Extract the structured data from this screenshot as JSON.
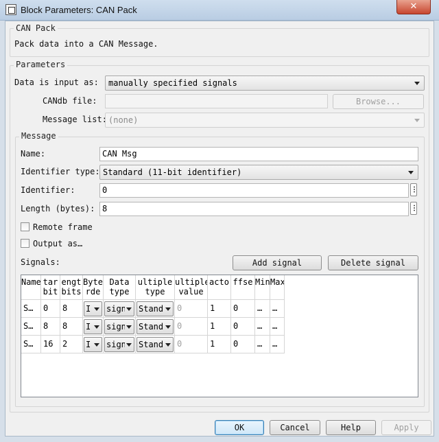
{
  "window": {
    "title": "Block Parameters: CAN Pack",
    "close_glyph": "✕"
  },
  "block": {
    "name": "CAN Pack",
    "description": "Pack data into a CAN Message."
  },
  "parameters": {
    "legend": "Parameters",
    "input_label": "Data is input as:",
    "input_value": "manually specified signals",
    "candb_label": "CANdb file:",
    "candb_value": "",
    "browse_label": "Browse...",
    "message_list_label": "Message list:",
    "message_list_value": "(none)"
  },
  "message": {
    "legend": "Message",
    "name_label": "Name:",
    "name_value": "CAN Msg",
    "id_type_label": "Identifier type:",
    "id_type_value": "Standard (11-bit identifier)",
    "identifier_label": "Identifier:",
    "identifier_value": "0",
    "length_label": "Length (bytes):",
    "length_value": "8",
    "remote_frame_label": "Remote frame",
    "remote_frame_checked": false,
    "output_as_label": "Output as…",
    "output_as_checked": false,
    "more_glyph": "⋮"
  },
  "signals": {
    "label": "Signals:",
    "add_label": "Add signal",
    "delete_label": "Delete signal",
    "columns": [
      [
        "Name",
        ""
      ],
      [
        "tar",
        "bit"
      ],
      [
        "engt",
        "bits"
      ],
      [
        "Byte",
        "rde"
      ],
      [
        "Data",
        "type"
      ],
      [
        "ultiple",
        "type"
      ],
      [
        "ultiple",
        "value"
      ],
      [
        "acto",
        ""
      ],
      [
        "ffse",
        ""
      ],
      [
        "Min",
        ""
      ],
      [
        "Max",
        ""
      ]
    ],
    "rows": [
      {
        "name": "S…",
        "start": "0",
        "length": "8",
        "byte_order": "I",
        "data_type": "sign",
        "mux_type": "Stand",
        "mux_value": "0",
        "factor": "1",
        "offset": "0",
        "min": "…",
        "max": "…"
      },
      {
        "name": "S…",
        "start": "8",
        "length": "8",
        "byte_order": "I",
        "data_type": "sign",
        "mux_type": "Stand",
        "mux_value": "0",
        "factor": "1",
        "offset": "0",
        "min": "…",
        "max": "…"
      },
      {
        "name": "S…",
        "start": "16",
        "length": "2",
        "byte_order": "I",
        "data_type": "sign",
        "mux_type": "Stand",
        "mux_value": "0",
        "factor": "1",
        "offset": "0",
        "min": "…",
        "max": "…"
      }
    ]
  },
  "buttons": {
    "ok": "OK",
    "cancel": "Cancel",
    "help": "Help",
    "apply": "Apply"
  }
}
